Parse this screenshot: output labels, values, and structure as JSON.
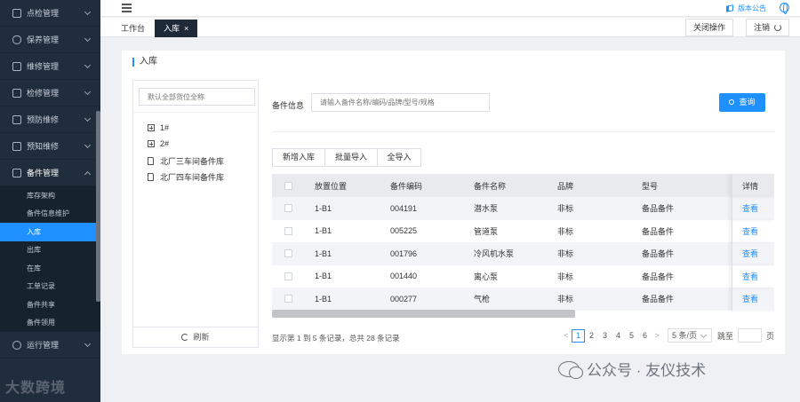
{
  "sidebar": {
    "items": [
      {
        "label": "点检管理",
        "icon": "checkbox-icon"
      },
      {
        "label": "保养管理",
        "icon": "shield-icon"
      },
      {
        "label": "维修管理",
        "icon": "wrench-icon"
      },
      {
        "label": "检修管理",
        "icon": "tool-icon"
      },
      {
        "label": "预防维修",
        "icon": "doc-icon"
      },
      {
        "label": "预知维修",
        "icon": "doc-icon"
      },
      {
        "label": "备件管理",
        "icon": "doc-icon"
      }
    ],
    "sub_items": [
      {
        "label": "库存架构"
      },
      {
        "label": "备件信息维护"
      },
      {
        "label": "入库"
      },
      {
        "label": "出库"
      },
      {
        "label": "在库"
      },
      {
        "label": "工单记录"
      },
      {
        "label": "备件共享"
      },
      {
        "label": "备件领用"
      }
    ],
    "bottom_item": {
      "label": "运行管理",
      "icon": "gear-icon"
    }
  },
  "watermark_left": "大数跨境",
  "watermark_right": "公众号 · 友仪技术",
  "topbar": {
    "notice": "版本公告"
  },
  "tabs": [
    {
      "label": "工作台"
    },
    {
      "label": "入库",
      "close": "×"
    }
  ],
  "tab_actions": {
    "close_ops": "关闭操作",
    "logout": "注销"
  },
  "page": {
    "title": "入库"
  },
  "tree": {
    "search_placeholder": "默认全部货位全称",
    "nodes": [
      {
        "label": "1#",
        "type": "expandable"
      },
      {
        "label": "2#",
        "type": "expandable"
      },
      {
        "label": "北厂三车间备件库",
        "type": "file"
      },
      {
        "label": "北厂四车间备件库",
        "type": "file"
      }
    ],
    "refresh": "刷新"
  },
  "search": {
    "label": "备件信息",
    "placeholder": "请输入备件名称/编码/品牌/型号/规格",
    "button": "查询"
  },
  "actions": {
    "add": "新增入库",
    "batch": "批量导入",
    "all": "全导入"
  },
  "table": {
    "headers": [
      "放置位置",
      "备件编码",
      "备件名称",
      "品牌",
      "型号",
      "详情"
    ],
    "rows": [
      [
        "1-B1",
        "004191",
        "潜水泵",
        "非标",
        "备品备件",
        "查看"
      ],
      [
        "1-B1",
        "005225",
        "管道泵",
        "非标",
        "备品备件",
        "查看"
      ],
      [
        "1-B1",
        "001796",
        "冷风机水泵",
        "非标",
        "备品备件",
        "查看"
      ],
      [
        "1-B1",
        "001440",
        "离心泵",
        "非标",
        "备品备件",
        "查看"
      ],
      [
        "1-B1",
        "000277",
        "气枪",
        "非标",
        "备品备件",
        "查看"
      ]
    ]
  },
  "pagination": {
    "summary": "显示第 1 到 5 条记录，总共 28 条记录",
    "prev": "<",
    "next": ">",
    "pages": [
      "1",
      "2",
      "3",
      "4",
      "5",
      "6"
    ],
    "page_size": "5 条/页",
    "goto_label": "跳至",
    "page_suffix": "页"
  }
}
